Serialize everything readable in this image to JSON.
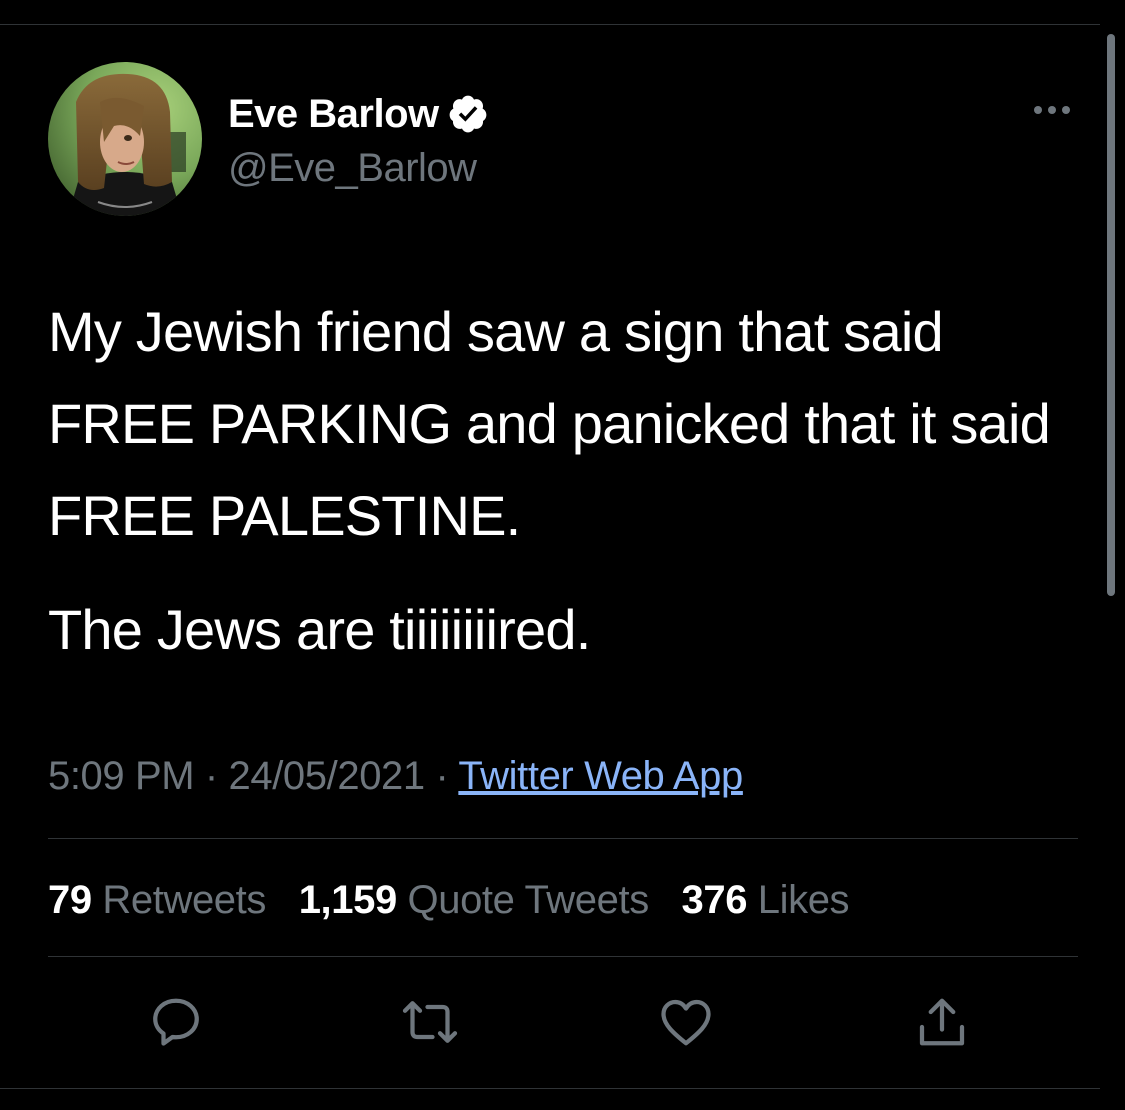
{
  "tweet": {
    "author": {
      "name": "Eve Barlow",
      "handle": "@Eve_Barlow",
      "verified": true
    },
    "text_line1": "My Jewish friend saw a sign that said FREE PARKING and panicked that it said FREE PALESTINE.",
    "text_line2": "The Jews are tiiiiiiiired.",
    "meta": {
      "time": "5:09 PM",
      "separator": " · ",
      "date": "24/05/2021",
      "source": "Twitter Web App"
    },
    "stats": {
      "retweets_count": "79",
      "retweets_label": "Retweets",
      "quotes_count": "1,159",
      "quotes_label": "Quote Tweets",
      "likes_count": "376",
      "likes_label": "Likes"
    },
    "actions": [
      "reply-icon",
      "retweet-icon",
      "like-icon",
      "share-icon"
    ]
  },
  "colors": {
    "background": "#000000",
    "text_primary": "#ffffff",
    "text_secondary": "#6e767d",
    "link": "#8ab4f8",
    "divider": "#2f3336",
    "verified_badge": "#ffffff"
  }
}
